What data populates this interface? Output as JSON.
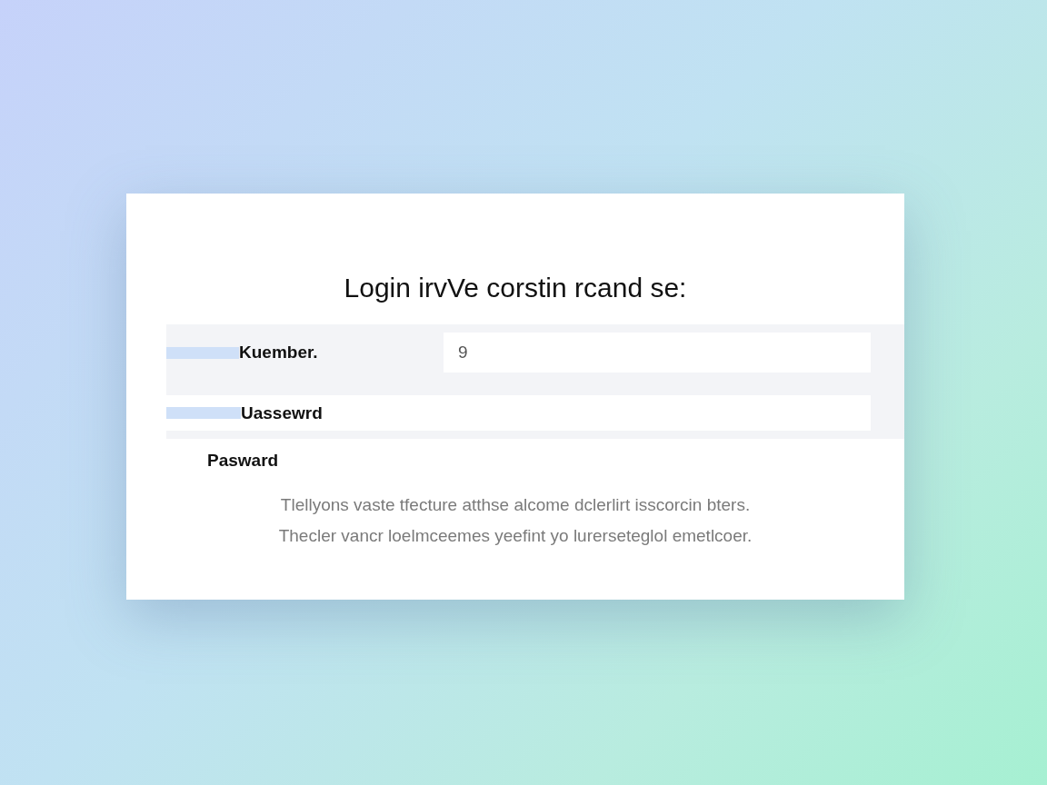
{
  "card": {
    "title": "Login irvVe corstin rcand se:",
    "fields": [
      {
        "kind": "inline",
        "label": "Kuember.",
        "value": "9"
      },
      {
        "kind": "boxed",
        "label": "Uassewrd"
      },
      {
        "kind": "plain",
        "label": "Pasward"
      }
    ],
    "description": [
      "Tlellyons vaste tfecture atthse alcome dclerlirt isscorcin bters.",
      "Thecler vancr loelmceemes yeefint yo lurerseteglol emetlcoer."
    ]
  }
}
